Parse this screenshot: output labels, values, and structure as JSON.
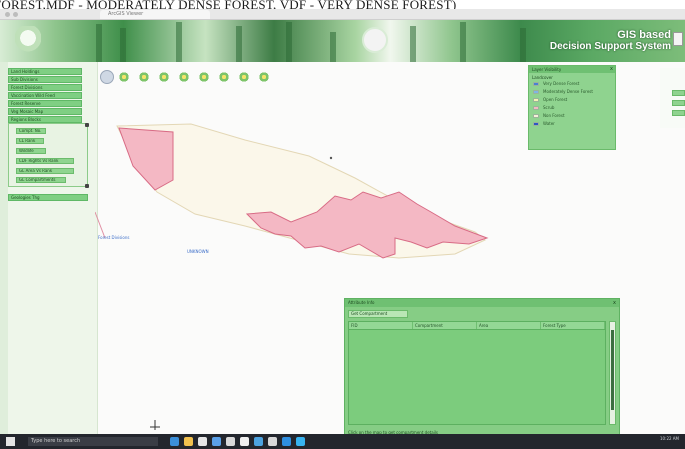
{
  "caption": {
    "text": "FOREST,MDF - MODERATELY DENSE FOREST, VDF - VERY DENSE FOREST)"
  },
  "browser": {
    "tab_title": "ArcGIS Viewer"
  },
  "banner": {
    "title_line1": "GIS based",
    "title_line2": "Decision Support System"
  },
  "sidebar": {
    "items": [
      {
        "label": "Land Holdings"
      },
      {
        "label": "Sub Divisions"
      },
      {
        "label": "Forest Divisions"
      },
      {
        "label": "Vaccination Wild Feed"
      },
      {
        "label": "Forest Reserve"
      },
      {
        "label": "Veg Mosaic Map"
      },
      {
        "label": "Regions Blocks"
      }
    ],
    "subitems": [
      {
        "label": "Compt. No."
      },
      {
        "label": "CL Rank"
      },
      {
        "label": "Wildlife"
      },
      {
        "label": "CDF Rights Vs Rank"
      },
      {
        "label": "GL Area Vs Rank"
      },
      {
        "label": "GL Compartments"
      }
    ],
    "bottom_item": {
      "label": "Geologies Thg"
    }
  },
  "map": {
    "label_left": "Forest Divisions",
    "label_mid": "UNKNOWN",
    "colors": {
      "polygon_fill": "#f4b8c4",
      "polygon_stroke": "#d86b85",
      "buffer": "#fbf7ea"
    }
  },
  "legend": {
    "title": "Layer Visibility",
    "subtitle": "Landcover",
    "close": "x",
    "items": [
      {
        "label": "Very Dense Forest",
        "color": "#4a7fd4"
      },
      {
        "label": "Moderately Dense Forest",
        "color": "#7fb5e6"
      },
      {
        "label": "Open Forest",
        "color": "#f6f2b5"
      },
      {
        "label": "Scrub",
        "color": "#f4b8c4"
      },
      {
        "label": "Non Forest",
        "color": "#f5f0da"
      },
      {
        "label": "Water",
        "color": "#2f55c4"
      }
    ]
  },
  "info_panel": {
    "title": "Attribute Info",
    "close": "x",
    "button_label": "Get Compartment",
    "columns": [
      "FID",
      "Compartment",
      "Area",
      "Forest Type"
    ],
    "rows": [
      [
        "",
        "",
        "",
        ""
      ]
    ],
    "footer": "Click on the map to get compartment details"
  },
  "taskbar": {
    "search_placeholder": "Type here to search",
    "clock": "10:22 AM"
  }
}
